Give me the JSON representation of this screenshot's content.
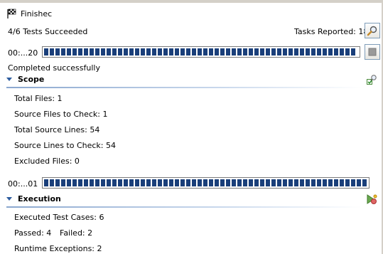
{
  "header": {
    "title": "Finishec",
    "tests_summary": "4/6 Tests Succeeded",
    "tasks_reported": "Tasks Reported: 18",
    "colors": {
      "progress_fill": "#1a3f7a",
      "section_line": "#8aa7cf",
      "accent": "#2e5d9f"
    }
  },
  "progress1": {
    "label": "00:...20",
    "fraction": 1.0
  },
  "status_text": "Completed successfully",
  "scope": {
    "title": "Scope",
    "rows": [
      "Total Files: 1",
      "Source Files to Check: 1",
      "Total Source Lines: 54",
      "Source Lines to Check: 54",
      "Excluded Files: 0"
    ]
  },
  "progress2": {
    "label": "00:...01",
    "fraction": 1.0
  },
  "execution": {
    "title": "Execution",
    "executed": "Executed Test Cases: 6",
    "passed": "Passed: 4",
    "failed": "Failed: 2",
    "runtime": "Runtime Exceptions: 2"
  },
  "icons": [
    "checkered-flag-icon",
    "magnifier-icon",
    "stop-icon",
    "scope-check-icon",
    "execution-run-icon",
    "collapse-triangle-icon"
  ]
}
